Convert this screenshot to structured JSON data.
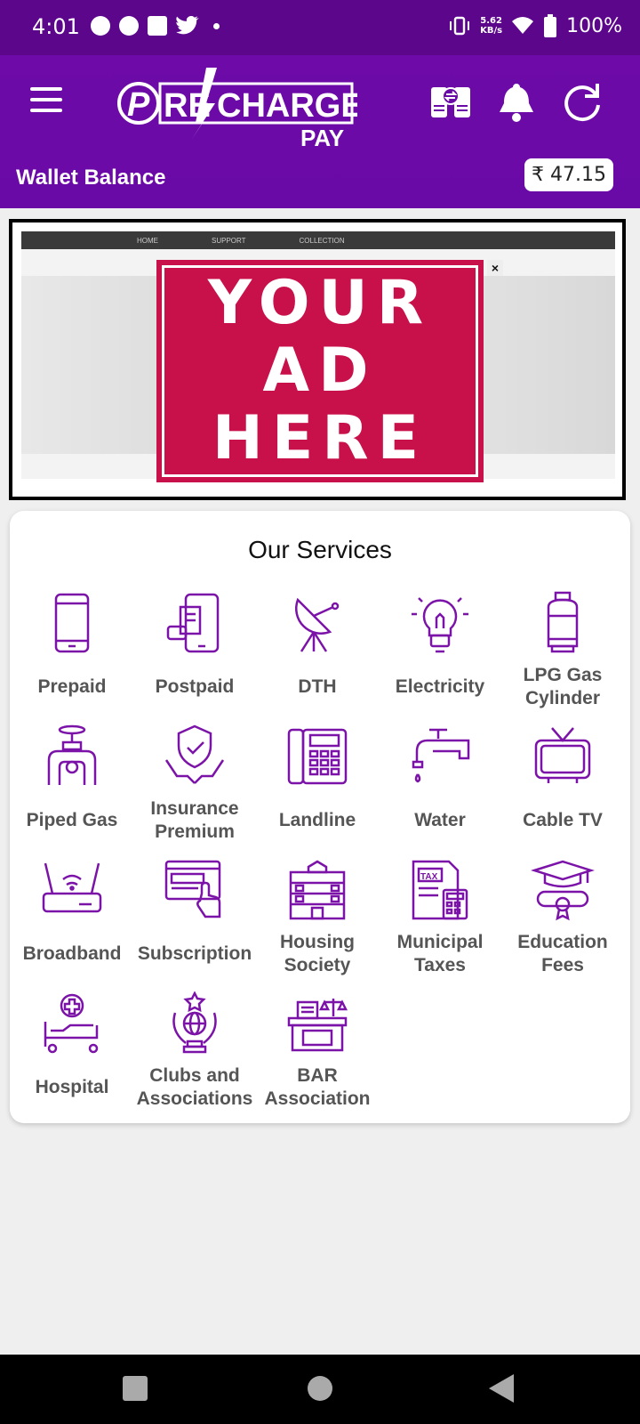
{
  "status_bar": {
    "time": "4:01",
    "speed_value": "5.62",
    "speed_unit": "KB/s",
    "battery": "100%"
  },
  "header": {
    "logo_text_1": "RE",
    "logo_text_2": "CHARGE",
    "logo_text_3": "PAY",
    "wallet_label": "Wallet Balance",
    "wallet_amount": "₹ 47.15"
  },
  "ad": {
    "nav_items": [
      "HOME",
      "SUPPORT",
      "COLLECTION"
    ],
    "close": "×",
    "line1": "YOUR",
    "line2": "AD",
    "line3": "HERE"
  },
  "services": {
    "title": "Our Services",
    "items": [
      {
        "label": "Prepaid",
        "icon": "mobile-icon"
      },
      {
        "label": "Postpaid",
        "icon": "postpaid-bill-icon"
      },
      {
        "label": "DTH",
        "icon": "satellite-dish-icon"
      },
      {
        "label": "Electricity",
        "icon": "bulb-icon"
      },
      {
        "label": "LPG Gas Cylinder",
        "icon": "gas-cylinder-icon"
      },
      {
        "label": "Piped Gas",
        "icon": "pipe-valve-icon"
      },
      {
        "label": "Insurance Premium",
        "icon": "insurance-shield-icon"
      },
      {
        "label": "Landline",
        "icon": "landline-phone-icon"
      },
      {
        "label": "Water",
        "icon": "water-tap-icon"
      },
      {
        "label": "Cable TV",
        "icon": "tv-icon"
      },
      {
        "label": "Broadband",
        "icon": "router-icon"
      },
      {
        "label": "Subscription",
        "icon": "subscription-icon"
      },
      {
        "label": "Housing Society",
        "icon": "building-icon"
      },
      {
        "label": "Municipal Taxes",
        "icon": "tax-document-icon"
      },
      {
        "label": "Education Fees",
        "icon": "graduation-cap-icon"
      },
      {
        "label": "Hospital",
        "icon": "hospital-bed-icon"
      },
      {
        "label": "Clubs and Associations",
        "icon": "club-globe-icon"
      },
      {
        "label": "BAR Association",
        "icon": "court-desk-icon"
      }
    ]
  },
  "colors": {
    "primary": "#6a0aa6",
    "status_bar": "#5c068c",
    "icon": "#7b13a8",
    "ad_red": "#c8104a"
  }
}
